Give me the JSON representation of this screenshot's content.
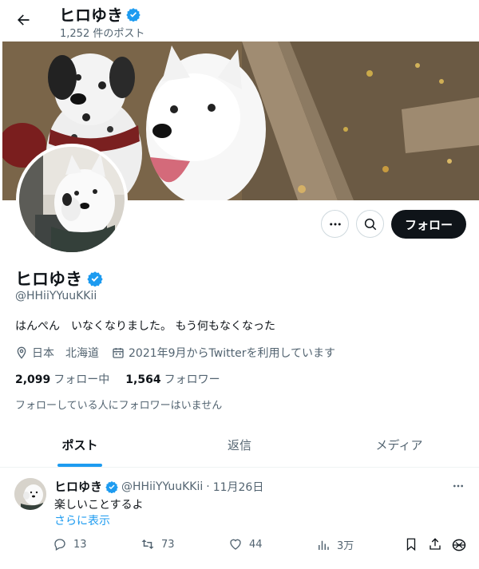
{
  "header": {
    "title": "ヒロゆき",
    "post_count": "1,252 件のポスト"
  },
  "profile": {
    "name": "ヒロゆき",
    "handle": "@HHiiYYuuKKii",
    "bio": "はんぺん　いなくなりました。 もう何もなくなった",
    "location": "日本　北海道",
    "joined": "2021年9月からTwitterを利用しています",
    "following_count": "2,099",
    "following_label": "フォロー中",
    "followers_count": "1,564",
    "followers_label": "フォロワー",
    "no_common_followers": "フォローしている人にフォロワーはいません"
  },
  "buttons": {
    "follow": "フォロー"
  },
  "tabs": [
    {
      "label": "ポスト",
      "active": true
    },
    {
      "label": "返信",
      "active": false
    },
    {
      "label": "メディア",
      "active": false
    }
  ],
  "post": {
    "name": "ヒロゆき",
    "handle": "@HHiiYYuuKKii",
    "separator": "·",
    "date": "11月26日",
    "text": "楽しいことするよ",
    "show_more": "さらに表示",
    "replies": "13",
    "reposts": "73",
    "likes": "44",
    "views": "3万"
  },
  "colors": {
    "accent": "#1d9bf0",
    "text": "#0f1419",
    "secondary": "#536471",
    "follow_button_bg": "#0f1419"
  },
  "icons": [
    "back-arrow-icon",
    "verified-badge-icon",
    "more-icon",
    "search-icon",
    "location-icon",
    "calendar-icon",
    "reply-icon",
    "repost-icon",
    "like-icon",
    "views-icon",
    "bookmark-icon",
    "share-icon",
    "grok-icon"
  ]
}
